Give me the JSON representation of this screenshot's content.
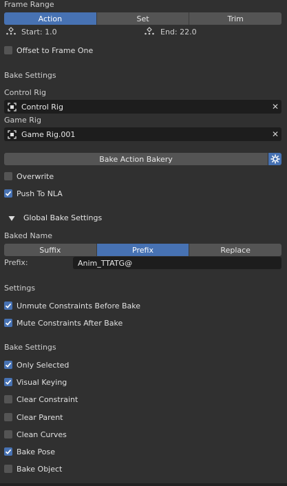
{
  "frame_range": {
    "title": "Frame Range",
    "tabs": [
      {
        "label": "Action",
        "active": true
      },
      {
        "label": "Set",
        "active": false
      },
      {
        "label": "Trim",
        "active": false
      }
    ],
    "start": "Start: 1.0",
    "end": "End: 22.0",
    "offset_label": "Offset to Frame One",
    "offset_checked": false
  },
  "bake_settings_header": "Bake Settings",
  "control_rig": {
    "label": "Control Rig",
    "value": "Control Rig"
  },
  "game_rig": {
    "label": "Game Rig",
    "value": "Game Rig.001"
  },
  "bake_button": "Bake Action Bakery",
  "overwrite": {
    "label": "Overwrite",
    "checked": false
  },
  "push_nla": {
    "label": "Push To NLA",
    "checked": true
  },
  "global_panel": {
    "title": "Global Bake Settings"
  },
  "baked_name": {
    "label": "Baked Name",
    "tabs": [
      {
        "label": "Suffix",
        "active": false
      },
      {
        "label": "Prefix",
        "active": true
      },
      {
        "label": "Replace",
        "active": false
      }
    ],
    "prefix_label": "Prefix:",
    "prefix_value": "Anim_TTATG@"
  },
  "settings": {
    "header": "Settings",
    "items": [
      {
        "label": "Unmute Constraints Before Bake",
        "checked": true
      },
      {
        "label": "Mute Constraints After Bake",
        "checked": true
      }
    ]
  },
  "bake_settings2": {
    "header": "Bake Settings",
    "items": [
      {
        "label": "Only Selected",
        "checked": true
      },
      {
        "label": "Visual Keying",
        "checked": true
      },
      {
        "label": "Clear Constraint",
        "checked": false
      },
      {
        "label": "Clear Parent",
        "checked": false
      },
      {
        "label": "Clean Curves",
        "checked": false
      },
      {
        "label": "Bake Pose",
        "checked": true
      },
      {
        "label": "Bake Object",
        "checked": false
      }
    ]
  },
  "colors": {
    "accent": "#4772b3",
    "background": "#303030",
    "field": "#1d1d1d",
    "button": "#545454"
  }
}
